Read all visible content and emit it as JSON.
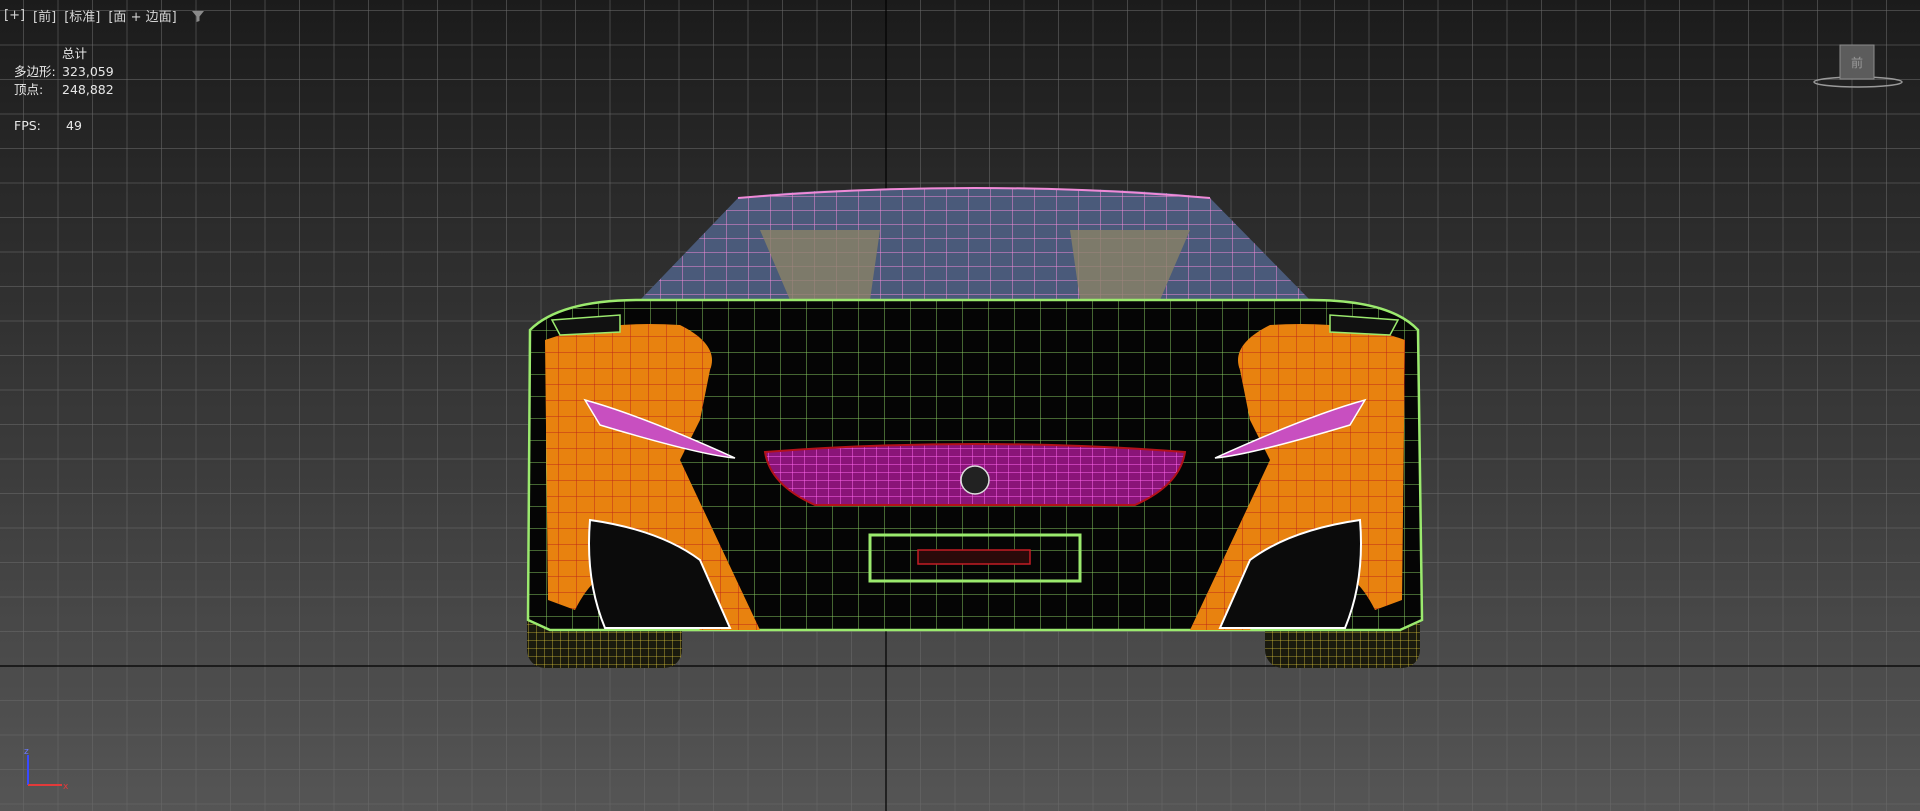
{
  "viewport": {
    "labels": [
      "[+]",
      "[前]",
      "[标准]",
      "[面 + 边面]"
    ],
    "filter_icon": "filter-icon"
  },
  "stats": {
    "header": "总计",
    "polygons_label": "多边形:",
    "polygons_value": "323,059",
    "vertices_label": "顶点:",
    "vertices_value": "248,882",
    "fps_label": "FPS:",
    "fps_value": "49"
  },
  "viewcube": {
    "icon": "viewcube-icon",
    "face_label": "前"
  },
  "axis_tripod": {
    "z_label": "z",
    "x_label": "x"
  },
  "colors": {
    "grid_line": "#6a6a6a",
    "axis_line": "#000000",
    "wire_green": "#9bea6e",
    "wire_pink": "#f08ad8",
    "body_orange": "#e8820f",
    "body_black": "#050505",
    "wire_red": "#b3121a",
    "wire_yellow": "#d8c23a",
    "grille_magenta": "#c51fb0"
  }
}
